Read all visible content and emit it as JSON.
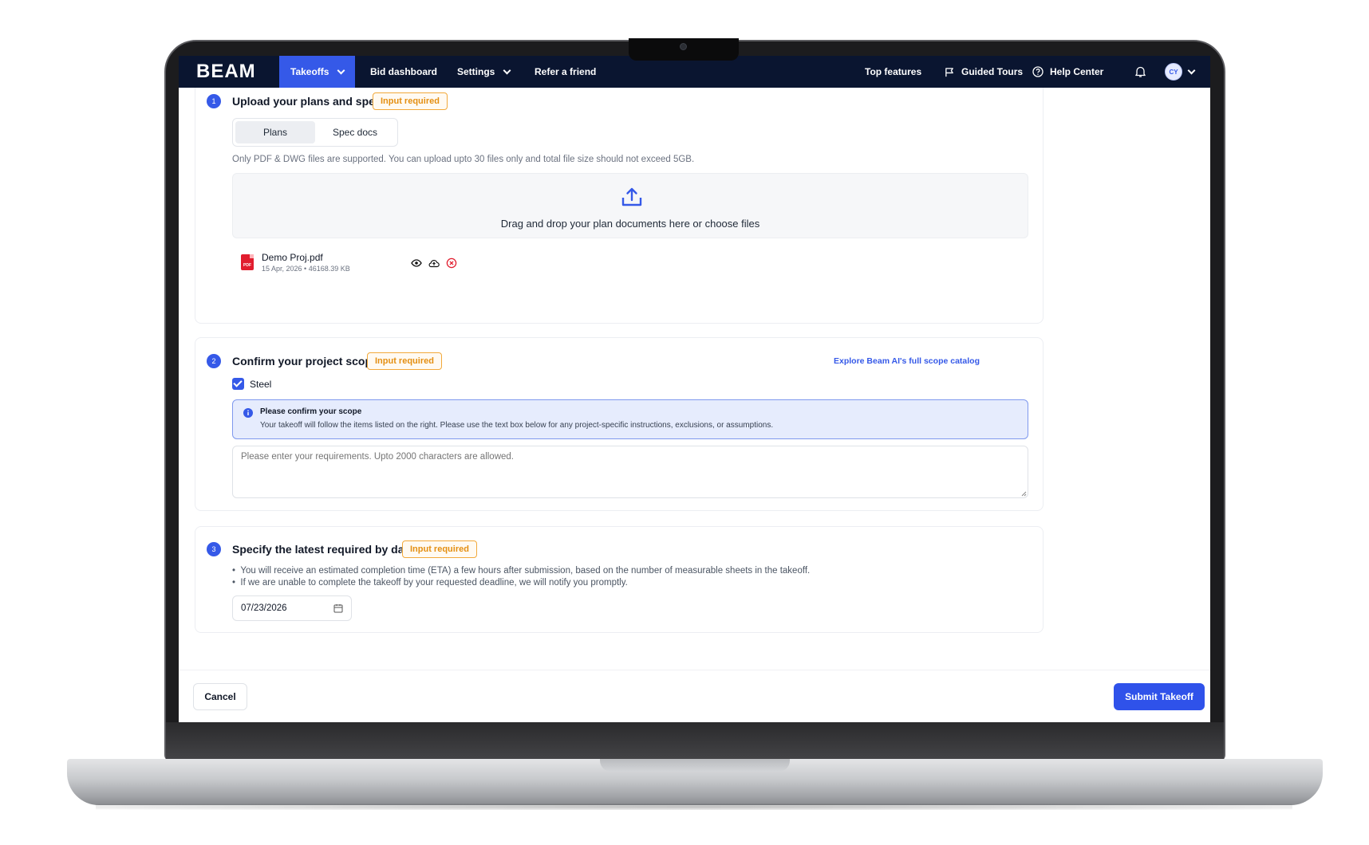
{
  "nav": {
    "logo": "BEAM",
    "items": [
      {
        "label": "Takeoffs",
        "active": true
      },
      {
        "label": "Bid dashboard"
      },
      {
        "label": "Settings"
      },
      {
        "label": "Refer a friend"
      }
    ],
    "right": {
      "top_features": "Top features",
      "guided_tours": "Guided Tours",
      "help_center": "Help Center",
      "avatar_initials": "CY"
    }
  },
  "step1": {
    "number": "1",
    "title": "Upload your plans and specs",
    "badge": "Input required",
    "tabs": [
      "Plans",
      "Spec docs"
    ],
    "selected_tab": "Plans",
    "note": "Only PDF & DWG files are supported. You can upload upto 30 files only and total file size should not exceed 5GB.",
    "dropzone_text": "Drag and drop your plan documents here or choose files",
    "file": {
      "icon_label": "PDF",
      "name": "Demo Proj.pdf",
      "meta": "15 Apr, 2026 • 46168.39 KB"
    }
  },
  "step2": {
    "number": "2",
    "title": "Confirm your project scope",
    "badge": "Input required",
    "catalog_link": "Explore Beam AI's full scope catalog",
    "checkbox_label": "Steel",
    "checkbox_checked": true,
    "info_title": "Please confirm your scope",
    "info_body": "Your takeoff will follow the items listed on the right. Please use the text box below for any project-specific instructions, exclusions, or assumptions.",
    "textarea_placeholder": "Please enter your requirements. Upto 2000 characters are allowed."
  },
  "step3": {
    "number": "3",
    "title": "Specify the latest required by date",
    "badge": "Input required",
    "bullets": [
      "You will receive an estimated completion time (ETA) a few hours after submission, based on the number of measurable sheets in the takeoff.",
      "If we are unable to complete the takeoff by your requested deadline, we will notify you promptly."
    ],
    "date_value": "07/23/2026"
  },
  "footer": {
    "cancel_label": "Cancel",
    "submit_label": "Submit Takeoff"
  },
  "colors": {
    "nav_bg": "#0a1530",
    "accent": "#3559e8",
    "badge_orange": "#e48f12",
    "danger": "#e11d2e"
  }
}
